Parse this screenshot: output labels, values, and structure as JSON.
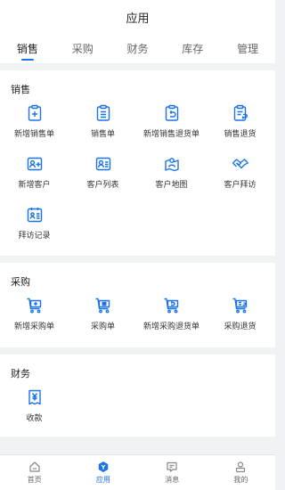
{
  "header": {
    "title": "应用"
  },
  "tabs": [
    {
      "label": "销售",
      "active": true
    },
    {
      "label": "采购",
      "active": false
    },
    {
      "label": "财务",
      "active": false
    },
    {
      "label": "库存",
      "active": false
    },
    {
      "label": "管理",
      "active": false
    }
  ],
  "sections": {
    "sales": {
      "title": "销售",
      "items": [
        {
          "label": "新增销售单",
          "icon": "add-doc-icon"
        },
        {
          "label": "销售单",
          "icon": "doc-list-icon"
        },
        {
          "label": "新增销售退货单",
          "icon": "return-doc-icon"
        },
        {
          "label": "销售退货",
          "icon": "return-list-icon"
        },
        {
          "label": "新增客户",
          "icon": "add-customer-icon"
        },
        {
          "label": "客户列表",
          "icon": "customer-list-icon"
        },
        {
          "label": "客户地图",
          "icon": "customer-map-icon"
        },
        {
          "label": "客户拜访",
          "icon": "handshake-icon"
        },
        {
          "label": "拜访记录",
          "icon": "visit-record-icon"
        }
      ]
    },
    "purchase": {
      "title": "采购",
      "items": [
        {
          "label": "新增采购单",
          "icon": "cart-add-icon"
        },
        {
          "label": "采购单",
          "icon": "cart-list-icon"
        },
        {
          "label": "新增采购退货单",
          "icon": "cart-return-icon"
        },
        {
          "label": "采购退货",
          "icon": "cart-return-list-icon"
        }
      ]
    },
    "finance": {
      "title": "财务",
      "items": [
        {
          "label": "收款",
          "icon": "receipt-yen-icon"
        }
      ]
    }
  },
  "bottom_nav": [
    {
      "label": "首页",
      "icon": "home-icon",
      "active": false
    },
    {
      "label": "应用",
      "icon": "apps-icon",
      "active": true
    },
    {
      "label": "消息",
      "icon": "message-icon",
      "active": false
    },
    {
      "label": "我的",
      "icon": "profile-icon",
      "active": false
    }
  ],
  "colors": {
    "accent": "#1a73e8",
    "background": "#f0f2f5",
    "surface": "#ffffff"
  }
}
